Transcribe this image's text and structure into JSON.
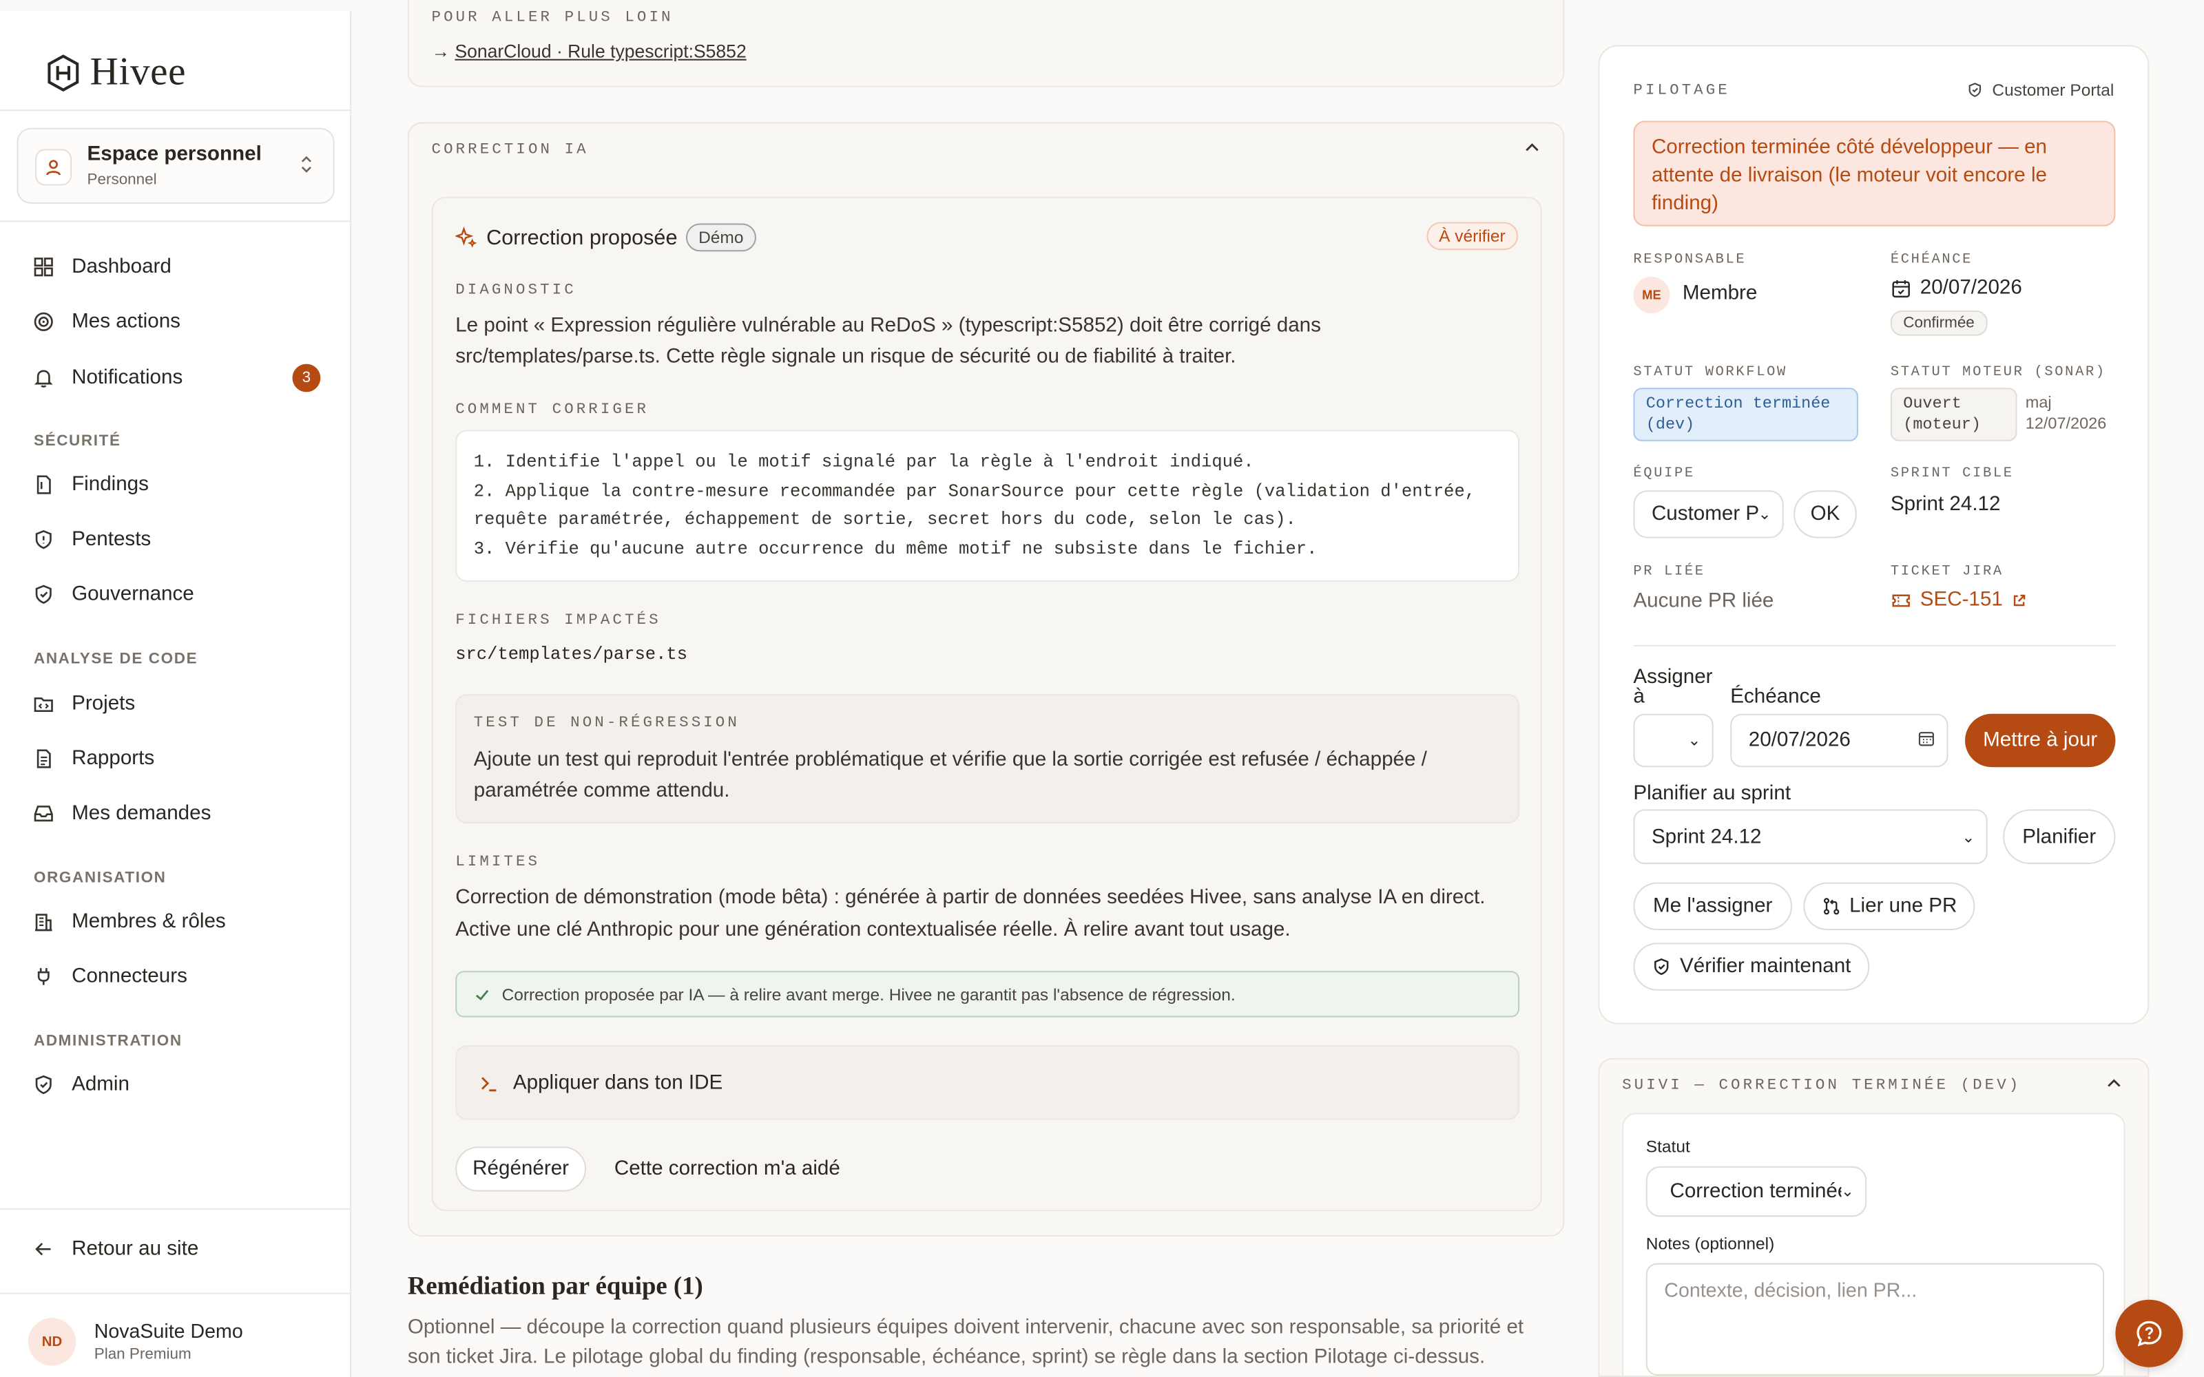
{
  "app": {
    "name": "Hivee"
  },
  "workspace": {
    "title": "Espace personnel",
    "subtitle": "Personnel"
  },
  "nav": {
    "dashboard": "Dashboard",
    "actions": "Mes actions",
    "notifications": "Notifications",
    "notifications_count": "3",
    "sec_security": "SÉCURITÉ",
    "findings": "Findings",
    "pentests": "Pentests",
    "governance": "Gouvernance",
    "sec_code": "ANALYSE DE CODE",
    "projects": "Projets",
    "reports": "Rapports",
    "requests": "Mes demandes",
    "sec_org": "ORGANISATION",
    "members": "Membres & rôles",
    "connectors": "Connecteurs",
    "sec_admin": "ADMINISTRATION",
    "admin": "Admin",
    "back": "Retour au site"
  },
  "user": {
    "initials": "ND",
    "name": "NovaSuite Demo",
    "plan": "Plan Premium"
  },
  "further": {
    "label": "POUR ALLER PLUS LOIN",
    "arrow": "→",
    "link": "SonarCloud · Rule typescript:S5852"
  },
  "correction": {
    "section": "CORRECTION IA",
    "title": "Correction proposée",
    "demo": "Démo",
    "status": "À vérifier",
    "diag_label": "DIAGNOSTIC",
    "diag_l1": "Le point « Expression régulière vulnérable au ReDoS » (typescript:S5852) doit être corrigé dans",
    "diag_l2": "src/templates/parse.ts. Cette règle signale un risque de sécurité ou de fiabilité à traiter.",
    "how_label": "COMMENT CORRIGER",
    "step1": "1. Identifie l'appel ou le motif signalé par la règle à l'endroit indiqué.",
    "step2a": "2. Applique la contre-mesure recommandée par SonarSource pour cette règle (validation d'entrée,",
    "step2b": "requête paramétrée, échappement de sortie, secret hors du code, selon le cas).",
    "step3": "3. Vérifie qu'aucune autre occurrence du même motif ne subsiste dans le fichier.",
    "files_label": "FICHIERS IMPACTÉS",
    "file": "src/templates/parse.ts",
    "test_label": "TEST DE NON-RÉGRESSION",
    "test_l1": "Ajoute un test qui reproduit l'entrée problématique et vérifie que la sortie corrigée est refusée / échappée /",
    "test_l2": "paramétrée comme attendu.",
    "limits_label": "LIMITES",
    "limits_l1": "Correction de démonstration (mode bêta) : générée à partir de données seedées Hivee, sans analyse IA en direct.",
    "limits_l2": "Active une clé Anthropic pour une génération contextualisée réelle. À relire avant tout usage.",
    "notice": "Correction proposée par IA — à relire avant merge. Hivee ne garantit pas l'absence de régression.",
    "ide": "Appliquer dans ton IDE",
    "regen": "Régénérer",
    "helped": "Cette correction m'a aidé"
  },
  "remediation": {
    "title": "Remédiation par équipe (1)",
    "l1": "Optionnel — découpe la correction quand plusieurs équipes doivent intervenir, chacune avec son responsable, sa priorité et",
    "l2": "son ticket Jira. Le pilotage global du finding (responsable, échéance, sprint) se règle dans la section Pilotage ci-dessus."
  },
  "pilotage": {
    "label": "PILOTAGE",
    "portal": "Customer Portal",
    "alert": "Correction terminée côté développeur — en attente de livraison (le moteur voit encore le finding)",
    "resp_label": "RESPONSABLE",
    "resp_initials": "ME",
    "resp_name": "Membre",
    "due_label": "ÉCHÉANCE",
    "due_date": "20/07/2026",
    "due_status": "Confirmée",
    "wf_label": "STATUT WORKFLOW",
    "wf_value": "Correction terminée (dev)",
    "engine_label": "STATUT MOTEUR (SONAR)",
    "engine_value": "Ouvert (moteur)",
    "engine_maj": "maj",
    "engine_date": "12/07/2026",
    "team_label": "ÉQUIPE",
    "team_value": "Customer Po",
    "team_ok": "OK",
    "sprint_label": "SPRINT CIBLE",
    "sprint_value": "Sprint 24.12",
    "pr_label": "PR LIÉE",
    "pr_value": "Aucune PR liée",
    "jira_label": "TICKET JIRA",
    "jira_value": "SEC-151",
    "assign_label": "Assigner à",
    "due_form_label": "Échéance",
    "due_input": "20/07/2026",
    "update": "Mettre à jour",
    "plan_label": "Planifier au sprint",
    "plan_value": "Sprint 24.12",
    "plan_btn": "Planifier",
    "assign_me": "Me l'assigner",
    "link_pr": "Lier une PR",
    "verify": "Vérifier maintenant"
  },
  "suivi": {
    "label": "SUIVI — CORRECTION TERMINÉE (DEV)",
    "status_label": "Statut",
    "status_value": "Correction terminée",
    "notes_label": "Notes (optionnel)",
    "notes_placeholder": "Contexte, décision, lien PR..."
  },
  "colors": {
    "accent": "#b54a12",
    "alert_bg": "#fbe7df",
    "workflow_bg": "#e3eefb"
  }
}
